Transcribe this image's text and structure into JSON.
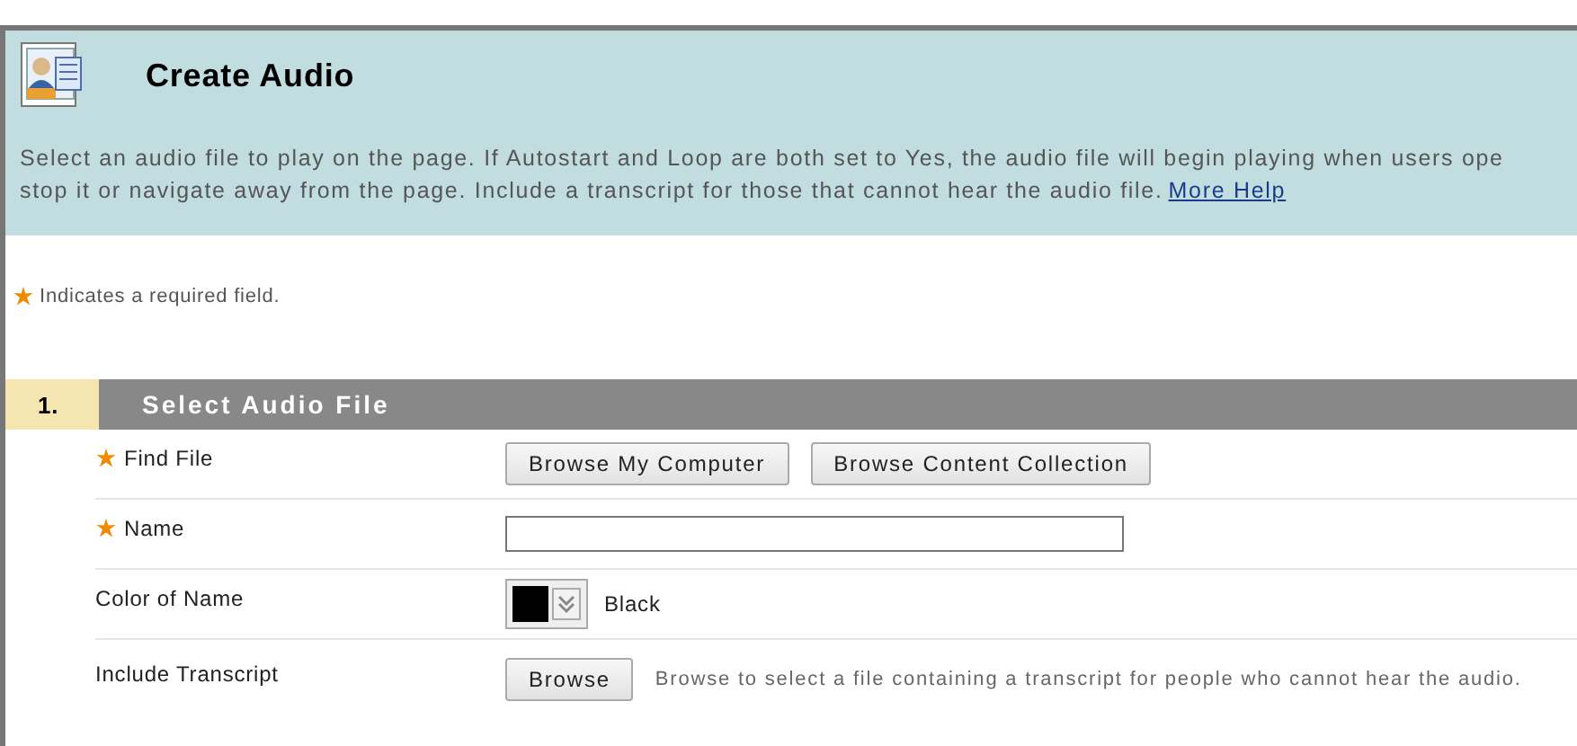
{
  "header": {
    "title": "Create Audio",
    "description_lines": [
      "Select an audio file to play on the page. If Autostart and Loop are both set to Yes, the audio file will begin playing when users ope",
      "stop it or navigate away from the page. Include a transcript for those that cannot hear the audio file."
    ],
    "help_link": "More Help"
  },
  "required_note": "Indicates a required field.",
  "section": {
    "number": "1.",
    "title": "Select Audio File"
  },
  "rows": [
    {
      "kind": "buttons",
      "label": "Find File",
      "required": true,
      "buttons": [
        "Browse My Computer",
        "Browse Content Collection"
      ]
    },
    {
      "kind": "text",
      "label": "Name",
      "required": true,
      "value": ""
    },
    {
      "kind": "color",
      "label": "Color of Name",
      "required": false,
      "color": "#000000",
      "color_name": "Black"
    },
    {
      "kind": "file",
      "label": "Include Transcript",
      "required": false,
      "buttons": [
        "Browse"
      ],
      "hint": "Browse to select a file containing a transcript for people who cannot hear the audio."
    }
  ]
}
